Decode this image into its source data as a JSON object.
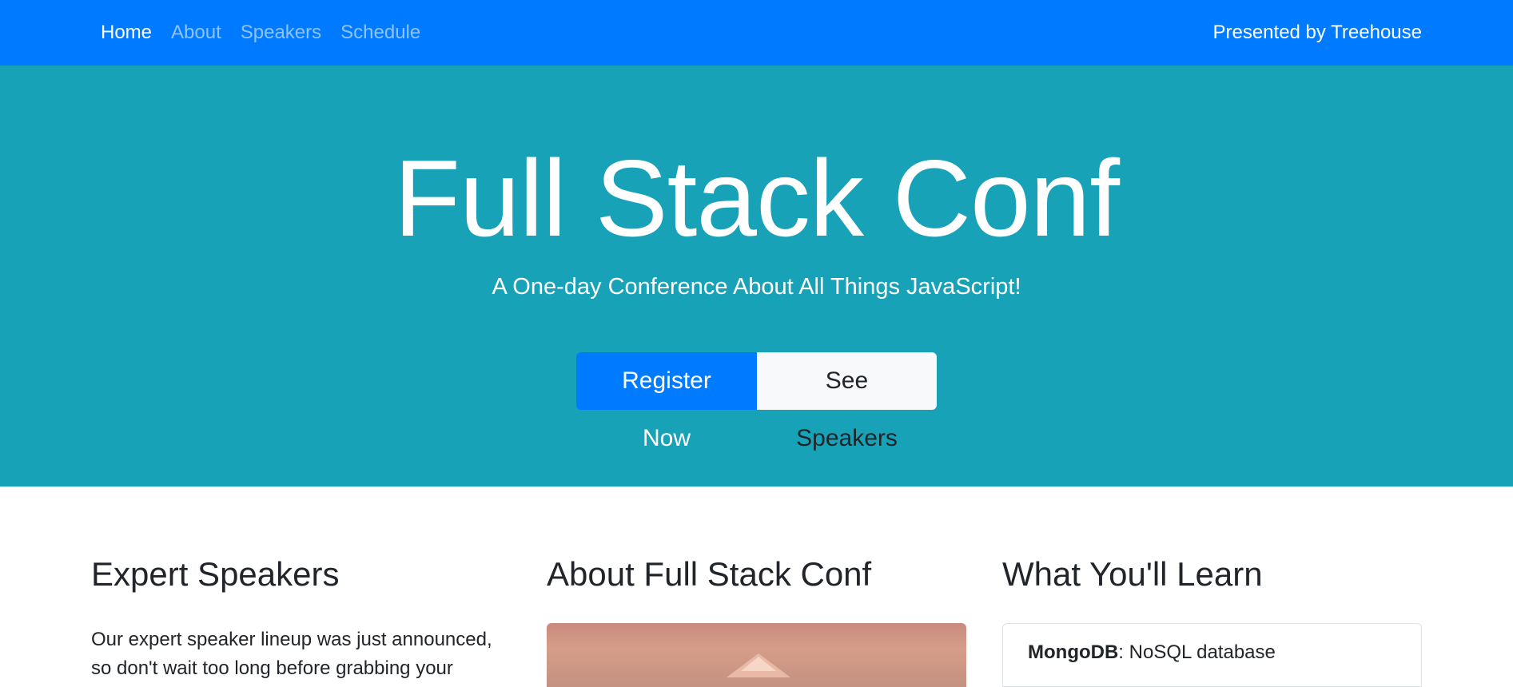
{
  "nav": {
    "links": [
      {
        "label": "Home",
        "active": true
      },
      {
        "label": "About",
        "active": false
      },
      {
        "label": "Speakers",
        "active": false
      },
      {
        "label": "Schedule",
        "active": false
      }
    ],
    "presented_by": "Presented by Treehouse"
  },
  "hero": {
    "title": "Full Stack Conf",
    "subtitle": "A One-day Conference About All Things JavaScript!",
    "register_button": "Register Now",
    "speakers_button": "See Speakers"
  },
  "sections": {
    "speakers": {
      "heading": "Expert Speakers",
      "text": "Our expert speaker lineup was just announced, so don't wait too long before grabbing your"
    },
    "about": {
      "heading": "About Full Stack Conf"
    },
    "learn": {
      "heading": "What You'll Learn",
      "items": [
        {
          "name": "MongoDB",
          "description": ": NoSQL database"
        }
      ]
    }
  },
  "colors": {
    "navbar": "#007bff",
    "hero": "#17a2b8",
    "primary_button": "#007bff",
    "light_button": "#f8f9fa"
  }
}
